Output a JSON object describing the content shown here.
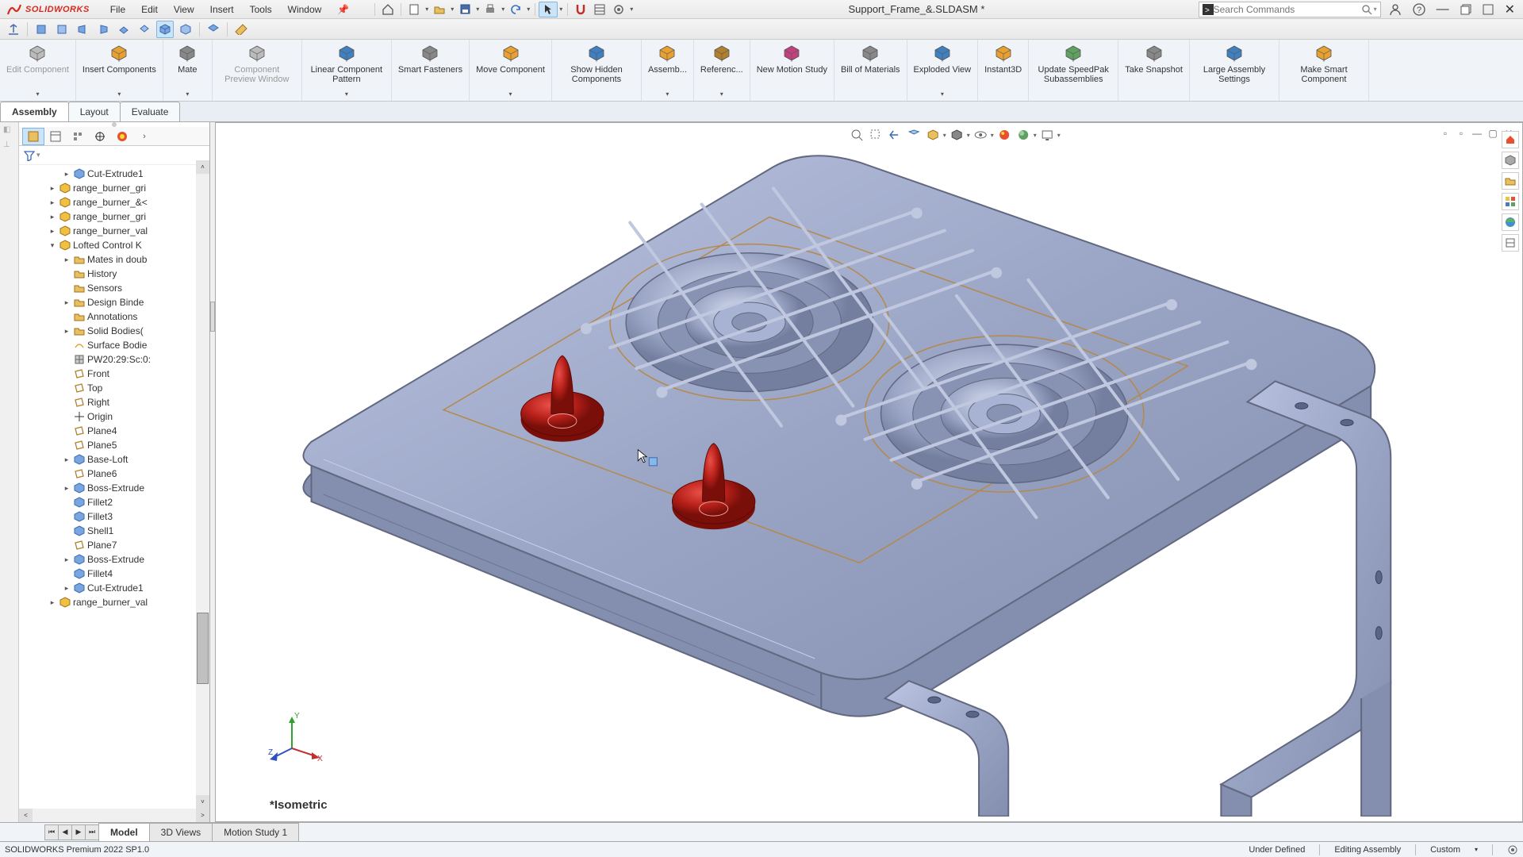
{
  "app": {
    "name": "SOLIDWORKS",
    "title": "Support_Frame_&.SLDASM *"
  },
  "menu": [
    "File",
    "Edit",
    "View",
    "Insert",
    "Tools",
    "Window"
  ],
  "search": {
    "placeholder": "Search Commands"
  },
  "ribbon": [
    {
      "id": "edit-component",
      "label": "Edit Component",
      "dim": true,
      "dd": true
    },
    {
      "id": "insert-components",
      "label": "Insert Components",
      "dd": true
    },
    {
      "id": "mate",
      "label": "Mate",
      "dd": true
    },
    {
      "id": "preview-window",
      "label": "Component Preview Window",
      "dim": true
    },
    {
      "id": "linear-pattern",
      "label": "Linear Component Pattern",
      "dd": true
    },
    {
      "id": "smart-fasteners",
      "label": "Smart Fasteners"
    },
    {
      "id": "move-component",
      "label": "Move Component",
      "dd": true
    },
    {
      "id": "show-hidden",
      "label": "Show Hidden Components"
    },
    {
      "id": "assembly-features",
      "label": "Assemb...",
      "dd": true
    },
    {
      "id": "reference-geom",
      "label": "Referenc...",
      "dd": true
    },
    {
      "id": "motion-study",
      "label": "New Motion Study"
    },
    {
      "id": "bom",
      "label": "Bill of Materials"
    },
    {
      "id": "exploded",
      "label": "Exploded View",
      "dd": true
    },
    {
      "id": "instant3d",
      "label": "Instant3D"
    },
    {
      "id": "speedpak",
      "label": "Update SpeedPak Subassemblies"
    },
    {
      "id": "snapshot",
      "label": "Take Snapshot"
    },
    {
      "id": "large-asm",
      "label": "Large Assembly Settings"
    },
    {
      "id": "smart-comp",
      "label": "Make Smart Component"
    }
  ],
  "doc_tabs": [
    "Assembly",
    "Layout",
    "Evaluate"
  ],
  "active_doc_tab": "Assembly",
  "tree": [
    {
      "indent": 3,
      "exp": "▸",
      "icon": "feat",
      "label": "Cut-Extrude1"
    },
    {
      "indent": 2,
      "exp": "▸",
      "icon": "comp",
      "label": "range_burner_gri"
    },
    {
      "indent": 2,
      "exp": "▸",
      "icon": "comp",
      "label": "range_burner_&<"
    },
    {
      "indent": 2,
      "exp": "▸",
      "icon": "comp",
      "label": "range_burner_gri"
    },
    {
      "indent": 2,
      "exp": "▸",
      "icon": "comp",
      "label": "range_burner_val"
    },
    {
      "indent": 2,
      "exp": "▾",
      "icon": "comp",
      "label": "Lofted Control K"
    },
    {
      "indent": 3,
      "exp": "▸",
      "icon": "fold",
      "label": "Mates in doub"
    },
    {
      "indent": 3,
      "exp": "",
      "icon": "fold",
      "label": "History"
    },
    {
      "indent": 3,
      "exp": "",
      "icon": "fold",
      "label": "Sensors"
    },
    {
      "indent": 3,
      "exp": "▸",
      "icon": "fold",
      "label": "Design Binde"
    },
    {
      "indent": 3,
      "exp": "",
      "icon": "fold",
      "label": "Annotations"
    },
    {
      "indent": 3,
      "exp": "▸",
      "icon": "fold",
      "label": "Solid Bodies("
    },
    {
      "indent": 3,
      "exp": "",
      "icon": "surf",
      "label": "Surface Bodie"
    },
    {
      "indent": 3,
      "exp": "",
      "icon": "mat",
      "label": "PW20:29:Sc:0:"
    },
    {
      "indent": 3,
      "exp": "",
      "icon": "plane",
      "label": "Front"
    },
    {
      "indent": 3,
      "exp": "",
      "icon": "plane",
      "label": "Top"
    },
    {
      "indent": 3,
      "exp": "",
      "icon": "plane",
      "label": "Right"
    },
    {
      "indent": 3,
      "exp": "",
      "icon": "orig",
      "label": "Origin"
    },
    {
      "indent": 3,
      "exp": "",
      "icon": "plane",
      "label": "Plane4"
    },
    {
      "indent": 3,
      "exp": "",
      "icon": "plane",
      "label": "Plane5"
    },
    {
      "indent": 3,
      "exp": "▸",
      "icon": "feat",
      "label": "Base-Loft"
    },
    {
      "indent": 3,
      "exp": "",
      "icon": "plane",
      "label": "Plane6"
    },
    {
      "indent": 3,
      "exp": "▸",
      "icon": "feat",
      "label": "Boss-Extrude"
    },
    {
      "indent": 3,
      "exp": "",
      "icon": "feat",
      "label": "Fillet2"
    },
    {
      "indent": 3,
      "exp": "",
      "icon": "feat",
      "label": "Fillet3"
    },
    {
      "indent": 3,
      "exp": "",
      "icon": "feat",
      "label": "Shell1"
    },
    {
      "indent": 3,
      "exp": "",
      "icon": "plane",
      "label": "Plane7"
    },
    {
      "indent": 3,
      "exp": "▸",
      "icon": "feat",
      "label": "Boss-Extrude"
    },
    {
      "indent": 3,
      "exp": "",
      "icon": "feat",
      "label": "Fillet4"
    },
    {
      "indent": 3,
      "exp": "▸",
      "icon": "feat",
      "label": "Cut-Extrude1"
    },
    {
      "indent": 2,
      "exp": "▸",
      "icon": "comp",
      "label": "range_burner_val"
    }
  ],
  "view_label": "*Isometric",
  "bottom_tabs": [
    "Model",
    "3D Views",
    "Motion Study 1"
  ],
  "active_bottom_tab": "Model",
  "status": {
    "left": "SOLIDWORKS Premium 2022 SP1.0",
    "under_defined": "Under Defined",
    "editing": "Editing Assembly",
    "custom": "Custom"
  },
  "colors": {
    "accent": "#DA291C",
    "steel": "#9aa4c4",
    "steel_light": "#b6bed8",
    "edge": "#616880",
    "knob": "#b8201a",
    "knob_dark": "#7a0f0a",
    "sketch": "#b5894a"
  }
}
